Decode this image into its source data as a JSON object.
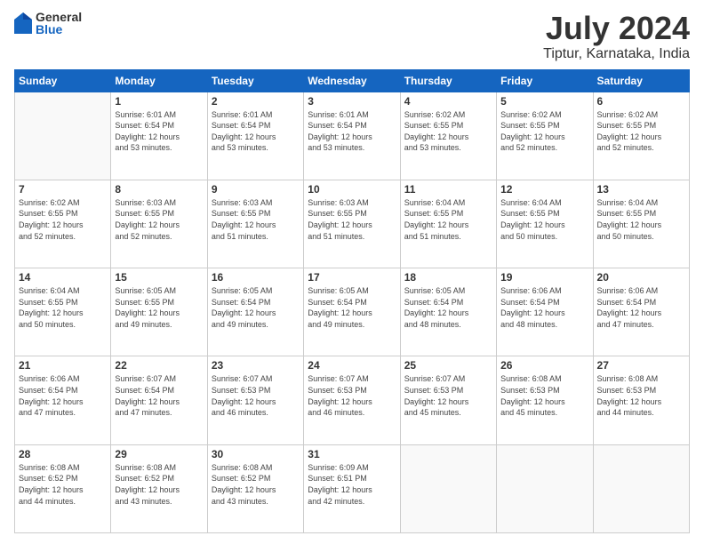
{
  "logo": {
    "general": "General",
    "blue": "Blue"
  },
  "title": {
    "month": "July 2024",
    "location": "Tiptur, Karnataka, India"
  },
  "weekdays": [
    "Sunday",
    "Monday",
    "Tuesday",
    "Wednesday",
    "Thursday",
    "Friday",
    "Saturday"
  ],
  "weeks": [
    [
      {
        "day": "",
        "info": ""
      },
      {
        "day": "1",
        "info": "Sunrise: 6:01 AM\nSunset: 6:54 PM\nDaylight: 12 hours\nand 53 minutes."
      },
      {
        "day": "2",
        "info": "Sunrise: 6:01 AM\nSunset: 6:54 PM\nDaylight: 12 hours\nand 53 minutes."
      },
      {
        "day": "3",
        "info": "Sunrise: 6:01 AM\nSunset: 6:54 PM\nDaylight: 12 hours\nand 53 minutes."
      },
      {
        "day": "4",
        "info": "Sunrise: 6:02 AM\nSunset: 6:55 PM\nDaylight: 12 hours\nand 53 minutes."
      },
      {
        "day": "5",
        "info": "Sunrise: 6:02 AM\nSunset: 6:55 PM\nDaylight: 12 hours\nand 52 minutes."
      },
      {
        "day": "6",
        "info": "Sunrise: 6:02 AM\nSunset: 6:55 PM\nDaylight: 12 hours\nand 52 minutes."
      }
    ],
    [
      {
        "day": "7",
        "info": "Sunrise: 6:02 AM\nSunset: 6:55 PM\nDaylight: 12 hours\nand 52 minutes."
      },
      {
        "day": "8",
        "info": "Sunrise: 6:03 AM\nSunset: 6:55 PM\nDaylight: 12 hours\nand 52 minutes."
      },
      {
        "day": "9",
        "info": "Sunrise: 6:03 AM\nSunset: 6:55 PM\nDaylight: 12 hours\nand 51 minutes."
      },
      {
        "day": "10",
        "info": "Sunrise: 6:03 AM\nSunset: 6:55 PM\nDaylight: 12 hours\nand 51 minutes."
      },
      {
        "day": "11",
        "info": "Sunrise: 6:04 AM\nSunset: 6:55 PM\nDaylight: 12 hours\nand 51 minutes."
      },
      {
        "day": "12",
        "info": "Sunrise: 6:04 AM\nSunset: 6:55 PM\nDaylight: 12 hours\nand 50 minutes."
      },
      {
        "day": "13",
        "info": "Sunrise: 6:04 AM\nSunset: 6:55 PM\nDaylight: 12 hours\nand 50 minutes."
      }
    ],
    [
      {
        "day": "14",
        "info": "Sunrise: 6:04 AM\nSunset: 6:55 PM\nDaylight: 12 hours\nand 50 minutes."
      },
      {
        "day": "15",
        "info": "Sunrise: 6:05 AM\nSunset: 6:55 PM\nDaylight: 12 hours\nand 49 minutes."
      },
      {
        "day": "16",
        "info": "Sunrise: 6:05 AM\nSunset: 6:54 PM\nDaylight: 12 hours\nand 49 minutes."
      },
      {
        "day": "17",
        "info": "Sunrise: 6:05 AM\nSunset: 6:54 PM\nDaylight: 12 hours\nand 49 minutes."
      },
      {
        "day": "18",
        "info": "Sunrise: 6:05 AM\nSunset: 6:54 PM\nDaylight: 12 hours\nand 48 minutes."
      },
      {
        "day": "19",
        "info": "Sunrise: 6:06 AM\nSunset: 6:54 PM\nDaylight: 12 hours\nand 48 minutes."
      },
      {
        "day": "20",
        "info": "Sunrise: 6:06 AM\nSunset: 6:54 PM\nDaylight: 12 hours\nand 47 minutes."
      }
    ],
    [
      {
        "day": "21",
        "info": "Sunrise: 6:06 AM\nSunset: 6:54 PM\nDaylight: 12 hours\nand 47 minutes."
      },
      {
        "day": "22",
        "info": "Sunrise: 6:07 AM\nSunset: 6:54 PM\nDaylight: 12 hours\nand 47 minutes."
      },
      {
        "day": "23",
        "info": "Sunrise: 6:07 AM\nSunset: 6:53 PM\nDaylight: 12 hours\nand 46 minutes."
      },
      {
        "day": "24",
        "info": "Sunrise: 6:07 AM\nSunset: 6:53 PM\nDaylight: 12 hours\nand 46 minutes."
      },
      {
        "day": "25",
        "info": "Sunrise: 6:07 AM\nSunset: 6:53 PM\nDaylight: 12 hours\nand 45 minutes."
      },
      {
        "day": "26",
        "info": "Sunrise: 6:08 AM\nSunset: 6:53 PM\nDaylight: 12 hours\nand 45 minutes."
      },
      {
        "day": "27",
        "info": "Sunrise: 6:08 AM\nSunset: 6:53 PM\nDaylight: 12 hours\nand 44 minutes."
      }
    ],
    [
      {
        "day": "28",
        "info": "Sunrise: 6:08 AM\nSunset: 6:52 PM\nDaylight: 12 hours\nand 44 minutes."
      },
      {
        "day": "29",
        "info": "Sunrise: 6:08 AM\nSunset: 6:52 PM\nDaylight: 12 hours\nand 43 minutes."
      },
      {
        "day": "30",
        "info": "Sunrise: 6:08 AM\nSunset: 6:52 PM\nDaylight: 12 hours\nand 43 minutes."
      },
      {
        "day": "31",
        "info": "Sunrise: 6:09 AM\nSunset: 6:51 PM\nDaylight: 12 hours\nand 42 minutes."
      },
      {
        "day": "",
        "info": ""
      },
      {
        "day": "",
        "info": ""
      },
      {
        "day": "",
        "info": ""
      }
    ]
  ]
}
